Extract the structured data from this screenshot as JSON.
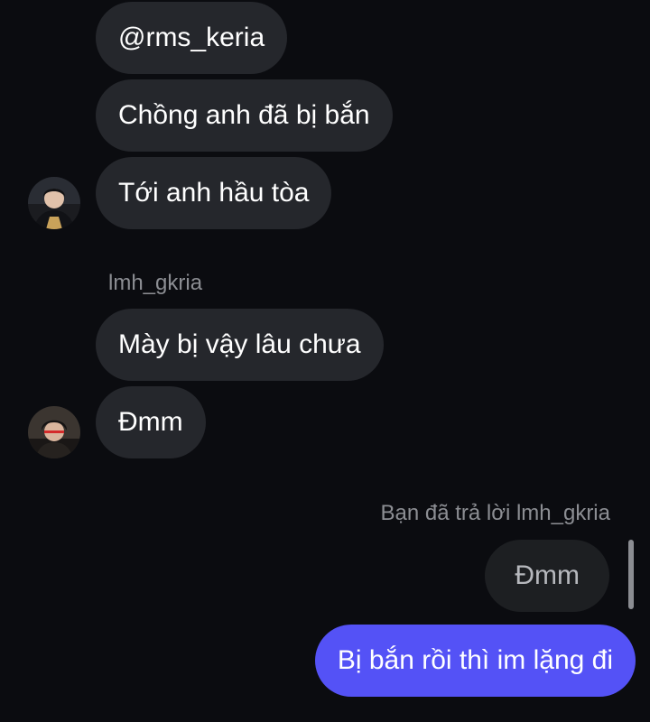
{
  "thread": {
    "messages": [
      {
        "text": "@rms_keria"
      },
      {
        "text": "Chồng anh đã bị bắn"
      },
      {
        "text": "Tới anh hầu tòa"
      }
    ],
    "second_sender": {
      "name": "lmh_gkria",
      "messages": [
        {
          "text": "Mày bị vậy lâu chưa"
        },
        {
          "text": "Đmm"
        }
      ]
    },
    "my_reply": {
      "note": "Bạn đã trả lời lmh_gkria",
      "quoted_text": "Đmm",
      "text": "Bị bắn rồi thì im lặng đi"
    }
  },
  "colors": {
    "background": "#0b0c10",
    "incoming_bubble": "#25272c",
    "quoted_bubble": "#1d1f22",
    "outgoing_bubble": "#5452f6",
    "meta_text": "#8c8e93"
  },
  "icons": {
    "avatar_1": "user-avatar-photo",
    "avatar_2": "user-avatar-photo"
  }
}
